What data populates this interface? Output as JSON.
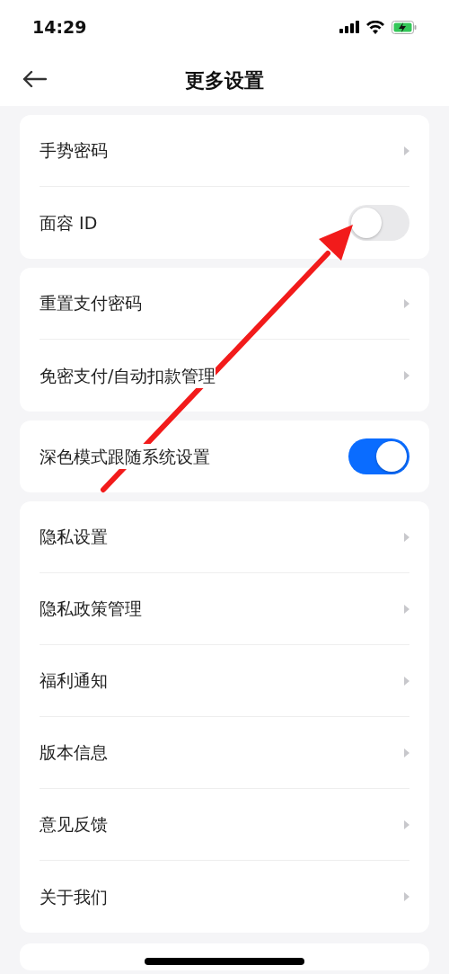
{
  "status_bar": {
    "time": "14:29"
  },
  "header": {
    "title": "更多设置"
  },
  "sections": [
    {
      "items": [
        {
          "label": "手势密码",
          "kind": "link"
        },
        {
          "label": "面容 ID",
          "kind": "toggle",
          "on": false
        }
      ]
    },
    {
      "items": [
        {
          "label": "重置支付密码",
          "kind": "link"
        },
        {
          "label": "免密支付/自动扣款管理",
          "kind": "link"
        }
      ]
    },
    {
      "items": [
        {
          "label": "深色模式跟随系统设置",
          "kind": "toggle",
          "on": true
        }
      ]
    },
    {
      "items": [
        {
          "label": "隐私设置",
          "kind": "link"
        },
        {
          "label": "隐私政策管理",
          "kind": "link"
        },
        {
          "label": "福利通知",
          "kind": "link"
        },
        {
          "label": "版本信息",
          "kind": "link"
        },
        {
          "label": "意见反馈",
          "kind": "link"
        },
        {
          "label": "关于我们",
          "kind": "link"
        }
      ]
    }
  ]
}
